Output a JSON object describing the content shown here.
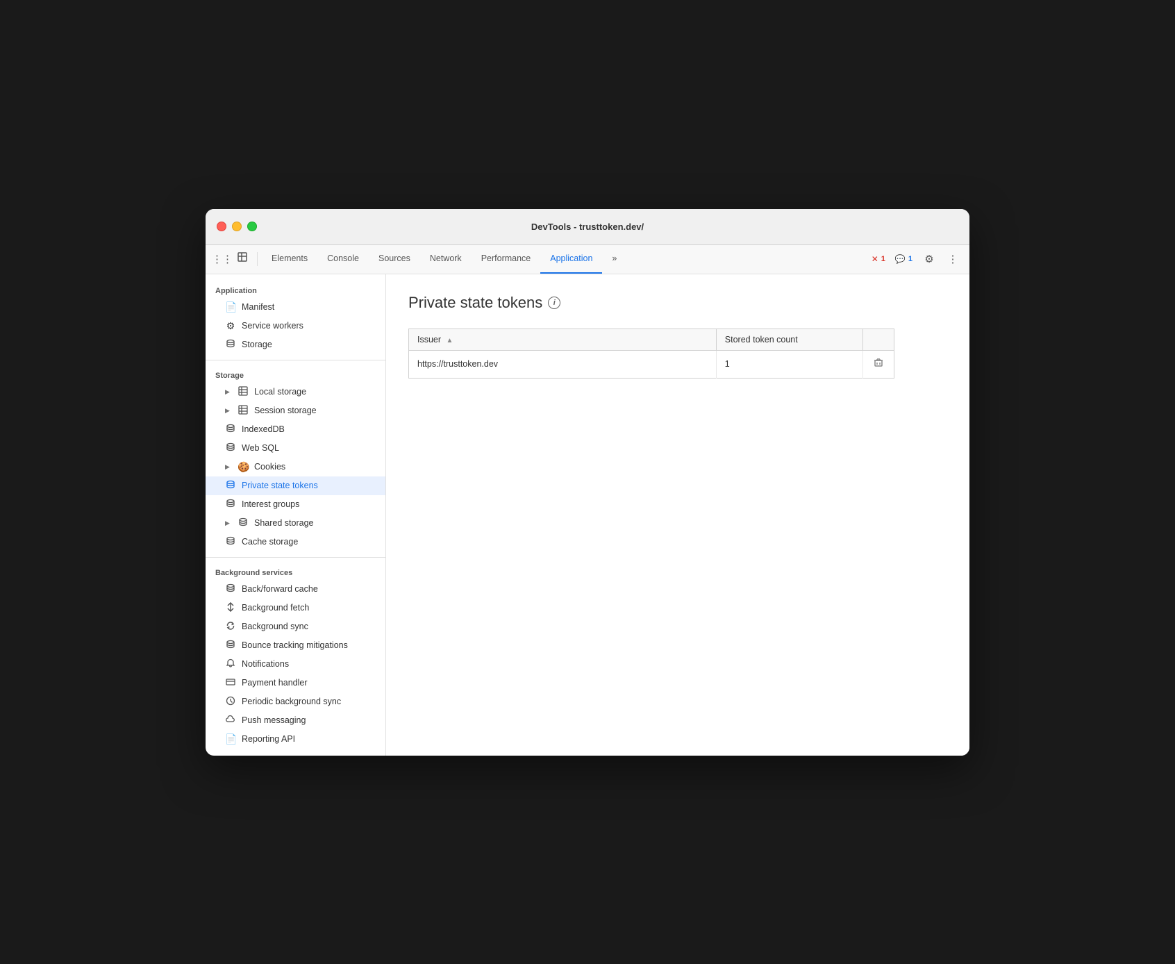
{
  "window": {
    "title": "DevTools - trusttoken.dev/"
  },
  "toolbar": {
    "cursor_icon": "⠿",
    "inspect_icon": "⬚",
    "tabs": [
      {
        "id": "elements",
        "label": "Elements",
        "active": false
      },
      {
        "id": "console",
        "label": "Console",
        "active": false
      },
      {
        "id": "sources",
        "label": "Sources",
        "active": false
      },
      {
        "id": "network",
        "label": "Network",
        "active": false
      },
      {
        "id": "performance",
        "label": "Performance",
        "active": false
      },
      {
        "id": "application",
        "label": "Application",
        "active": true
      },
      {
        "id": "more",
        "label": "»",
        "active": false
      }
    ],
    "error_count": "1",
    "warning_count": "1"
  },
  "sidebar": {
    "application_section": "Application",
    "items_application": [
      {
        "id": "manifest",
        "label": "Manifest",
        "icon": "📄",
        "indent": "indent1"
      },
      {
        "id": "service-workers",
        "label": "Service workers",
        "icon": "⚙",
        "indent": "indent1"
      },
      {
        "id": "storage",
        "label": "Storage",
        "icon": "🗄",
        "indent": "indent1"
      }
    ],
    "storage_section": "Storage",
    "items_storage": [
      {
        "id": "local-storage",
        "label": "Local storage",
        "icon": "⊞",
        "has_arrow": true,
        "indent": "indent1"
      },
      {
        "id": "session-storage",
        "label": "Session storage",
        "icon": "⊞",
        "has_arrow": true,
        "indent": "indent1"
      },
      {
        "id": "indexeddb",
        "label": "IndexedDB",
        "icon": "🗄",
        "has_arrow": false,
        "indent": "indent1"
      },
      {
        "id": "web-sql",
        "label": "Web SQL",
        "icon": "🗄",
        "has_arrow": false,
        "indent": "indent1"
      },
      {
        "id": "cookies",
        "label": "Cookies",
        "icon": "🍪",
        "has_arrow": true,
        "indent": "indent1"
      },
      {
        "id": "private-state-tokens",
        "label": "Private state tokens",
        "icon": "🗄",
        "has_arrow": false,
        "active": true,
        "indent": "indent1"
      },
      {
        "id": "interest-groups",
        "label": "Interest groups",
        "icon": "🗄",
        "has_arrow": false,
        "indent": "indent1"
      },
      {
        "id": "shared-storage",
        "label": "Shared storage",
        "icon": "🗄",
        "has_arrow": true,
        "indent": "indent1"
      },
      {
        "id": "cache-storage",
        "label": "Cache storage",
        "icon": "🗄",
        "has_arrow": false,
        "indent": "indent1"
      }
    ],
    "background_section": "Background services",
    "items_background": [
      {
        "id": "back-forward-cache",
        "label": "Back/forward cache",
        "icon": "🗄"
      },
      {
        "id": "background-fetch",
        "label": "Background fetch",
        "icon": "↕"
      },
      {
        "id": "background-sync",
        "label": "Background sync",
        "icon": "↻"
      },
      {
        "id": "bounce-tracking",
        "label": "Bounce tracking mitigations",
        "icon": "🗄"
      },
      {
        "id": "notifications",
        "label": "Notifications",
        "icon": "🔔"
      },
      {
        "id": "payment-handler",
        "label": "Payment handler",
        "icon": "💳"
      },
      {
        "id": "periodic-background-sync",
        "label": "Periodic background sync",
        "icon": "🕐"
      },
      {
        "id": "push-messaging",
        "label": "Push messaging",
        "icon": "☁"
      },
      {
        "id": "reporting-api",
        "label": "Reporting API",
        "icon": "📄"
      }
    ]
  },
  "panel": {
    "title": "Private state tokens",
    "table": {
      "col_issuer": "Issuer",
      "col_count": "Stored token count",
      "rows": [
        {
          "issuer": "https://trusttoken.dev",
          "count": "1"
        }
      ]
    }
  }
}
